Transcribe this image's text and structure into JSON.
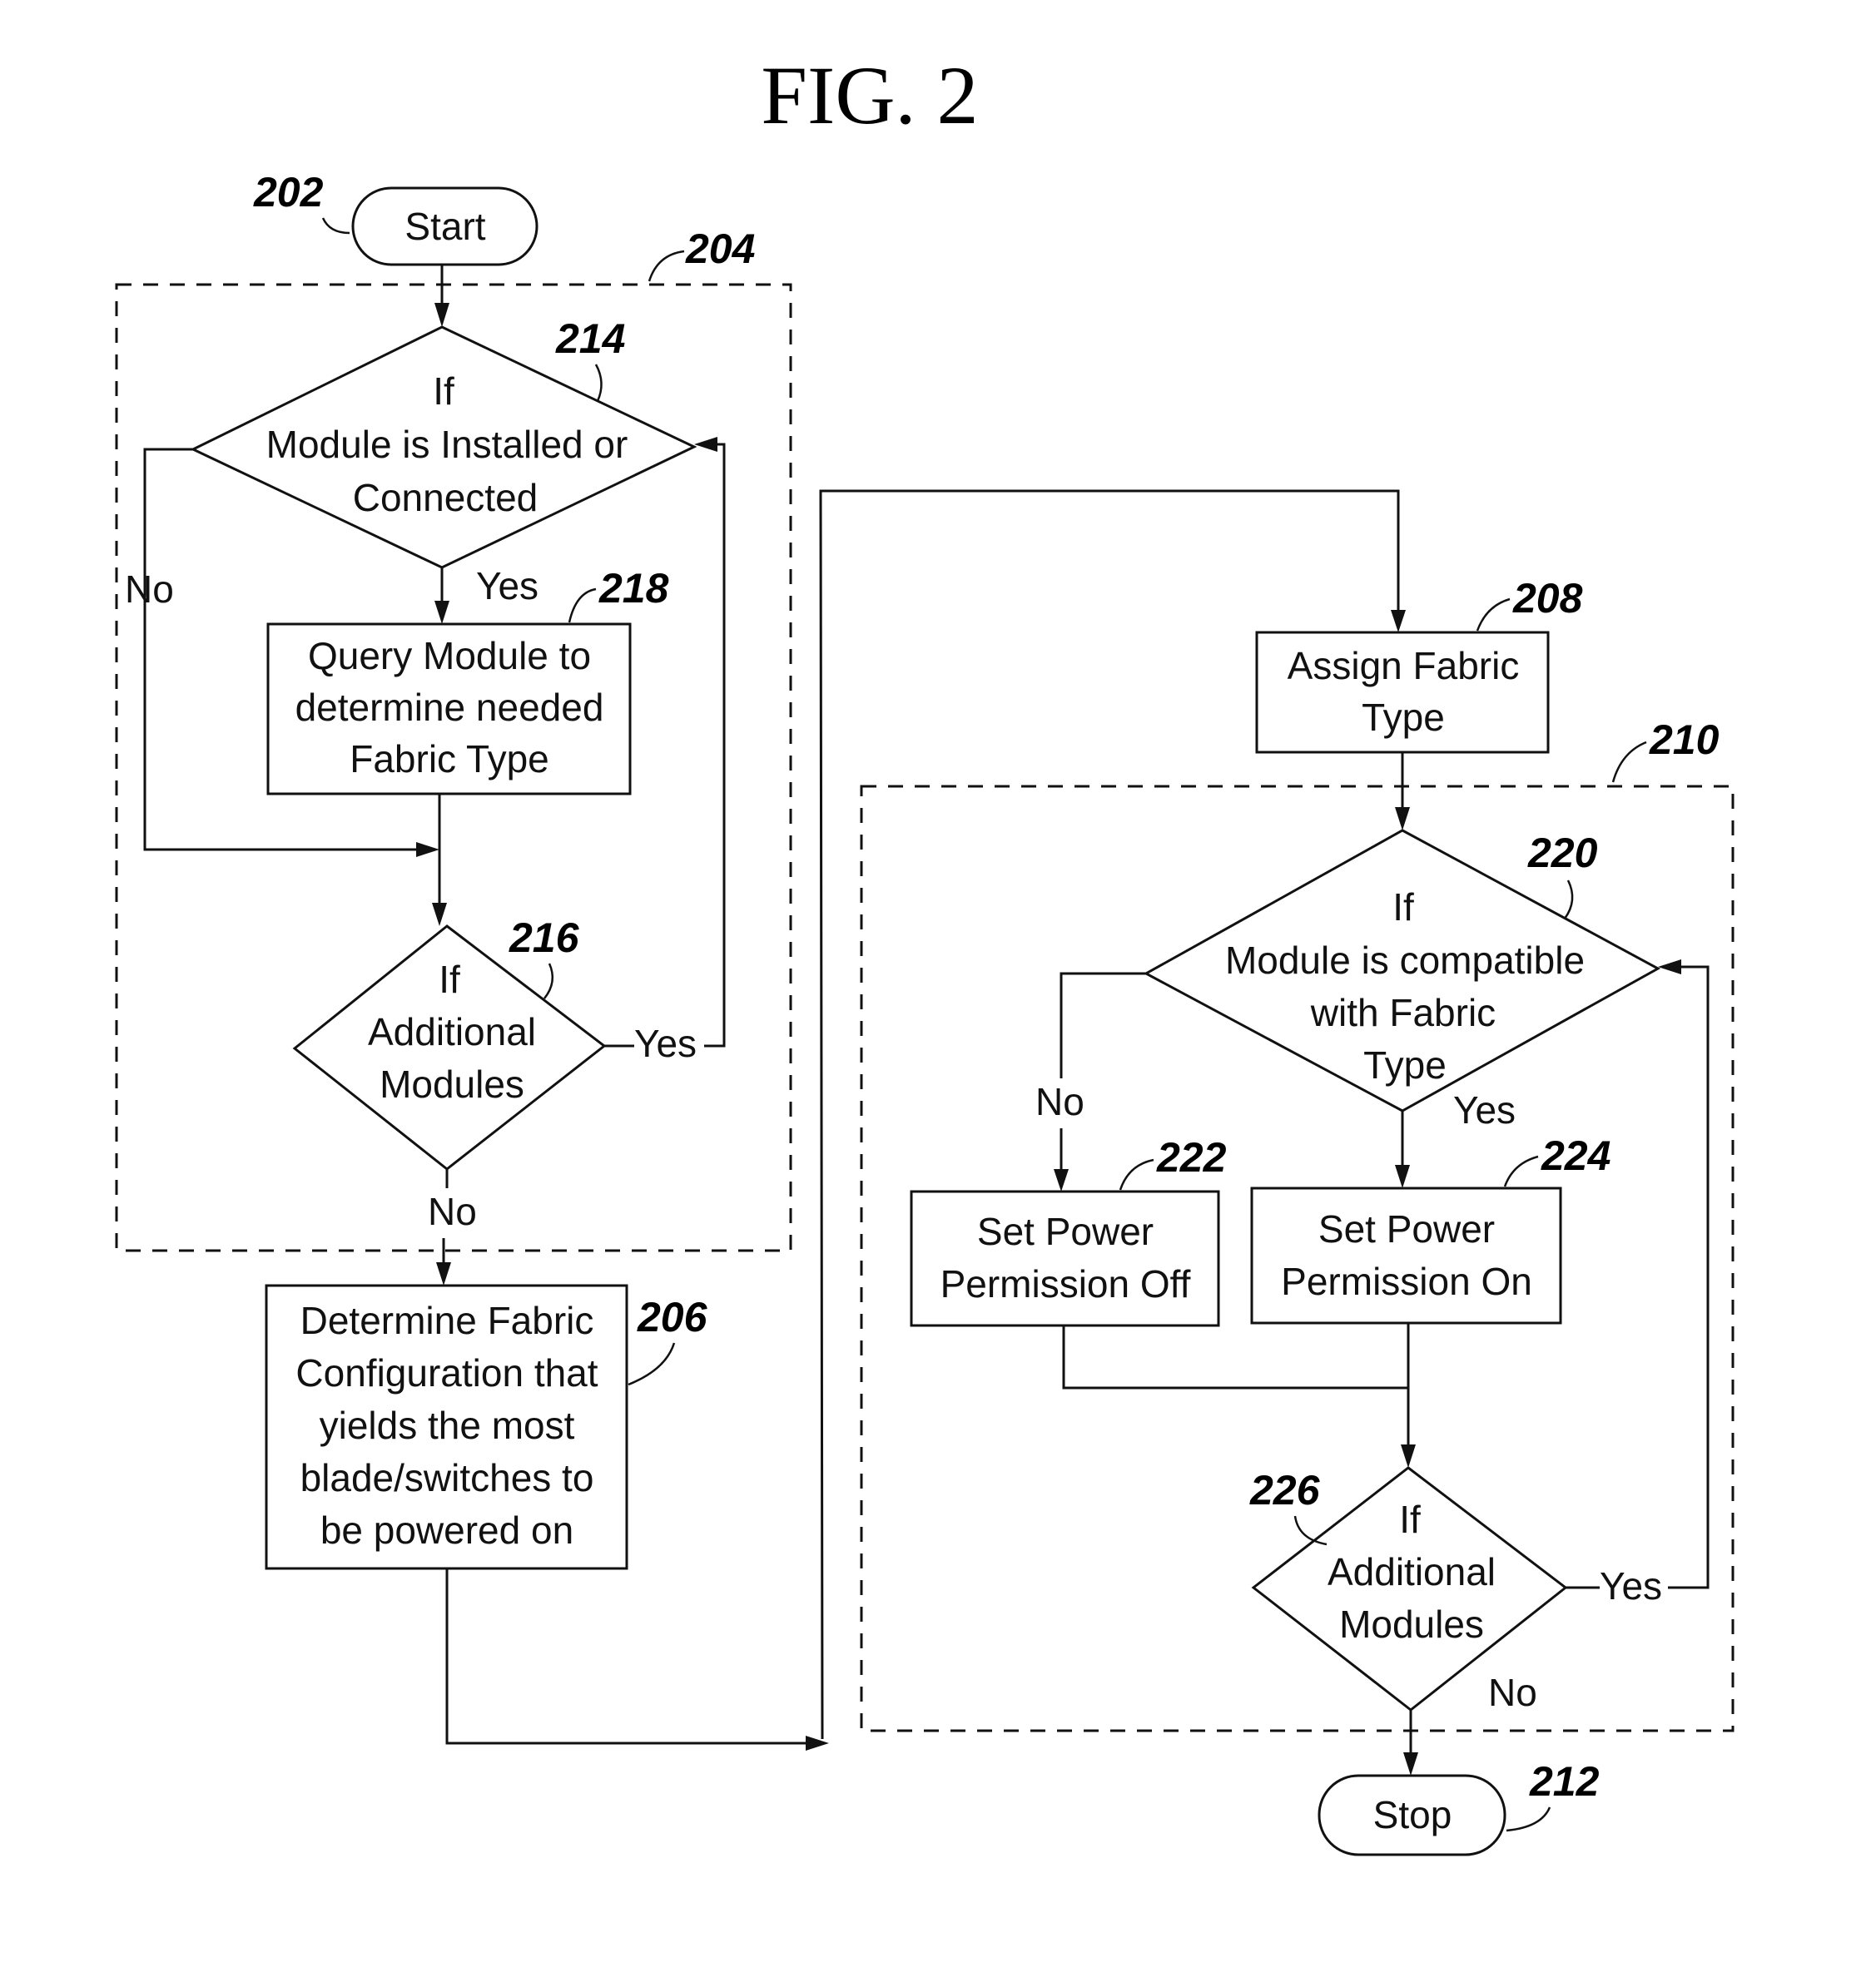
{
  "figure": {
    "title": "FIG. 2"
  },
  "nodes": {
    "start": {
      "ref": "202",
      "label": "Start"
    },
    "group_204": {
      "ref": "204"
    },
    "decision_214": {
      "ref": "214",
      "lines": [
        "If",
        "Module is Installed or",
        "Connected"
      ]
    },
    "process_218": {
      "ref": "218",
      "lines": [
        "Query Module to",
        "determine needed",
        "Fabric Type"
      ]
    },
    "decision_216": {
      "ref": "216",
      "lines": [
        "If",
        "Additional",
        "Modules"
      ]
    },
    "process_206": {
      "ref": "206",
      "lines": [
        "Determine Fabric",
        "Configuration that",
        "yields the most",
        "blade/switches to",
        "be powered on"
      ]
    },
    "process_208": {
      "ref": "208",
      "lines": [
        "Assign Fabric",
        "Type"
      ]
    },
    "group_210": {
      "ref": "210"
    },
    "decision_220": {
      "ref": "220",
      "lines": [
        "If",
        "Module is compatible",
        "with Fabric",
        "Type"
      ]
    },
    "process_222": {
      "ref": "222",
      "lines": [
        "Set Power",
        "Permission Off"
      ]
    },
    "process_224": {
      "ref": "224",
      "lines": [
        "Set Power",
        "Permission On"
      ]
    },
    "decision_226": {
      "ref": "226",
      "lines": [
        "If",
        "Additional",
        "Modules"
      ]
    },
    "stop": {
      "ref": "212",
      "label": "Stop"
    }
  },
  "branches": {
    "d214_no": "No",
    "d214_yes": "Yes",
    "d216_yes": "Yes",
    "d216_no": "No",
    "d220_no": "No",
    "d220_yes": "Yes",
    "d226_yes": "Yes",
    "d226_no": "No"
  }
}
